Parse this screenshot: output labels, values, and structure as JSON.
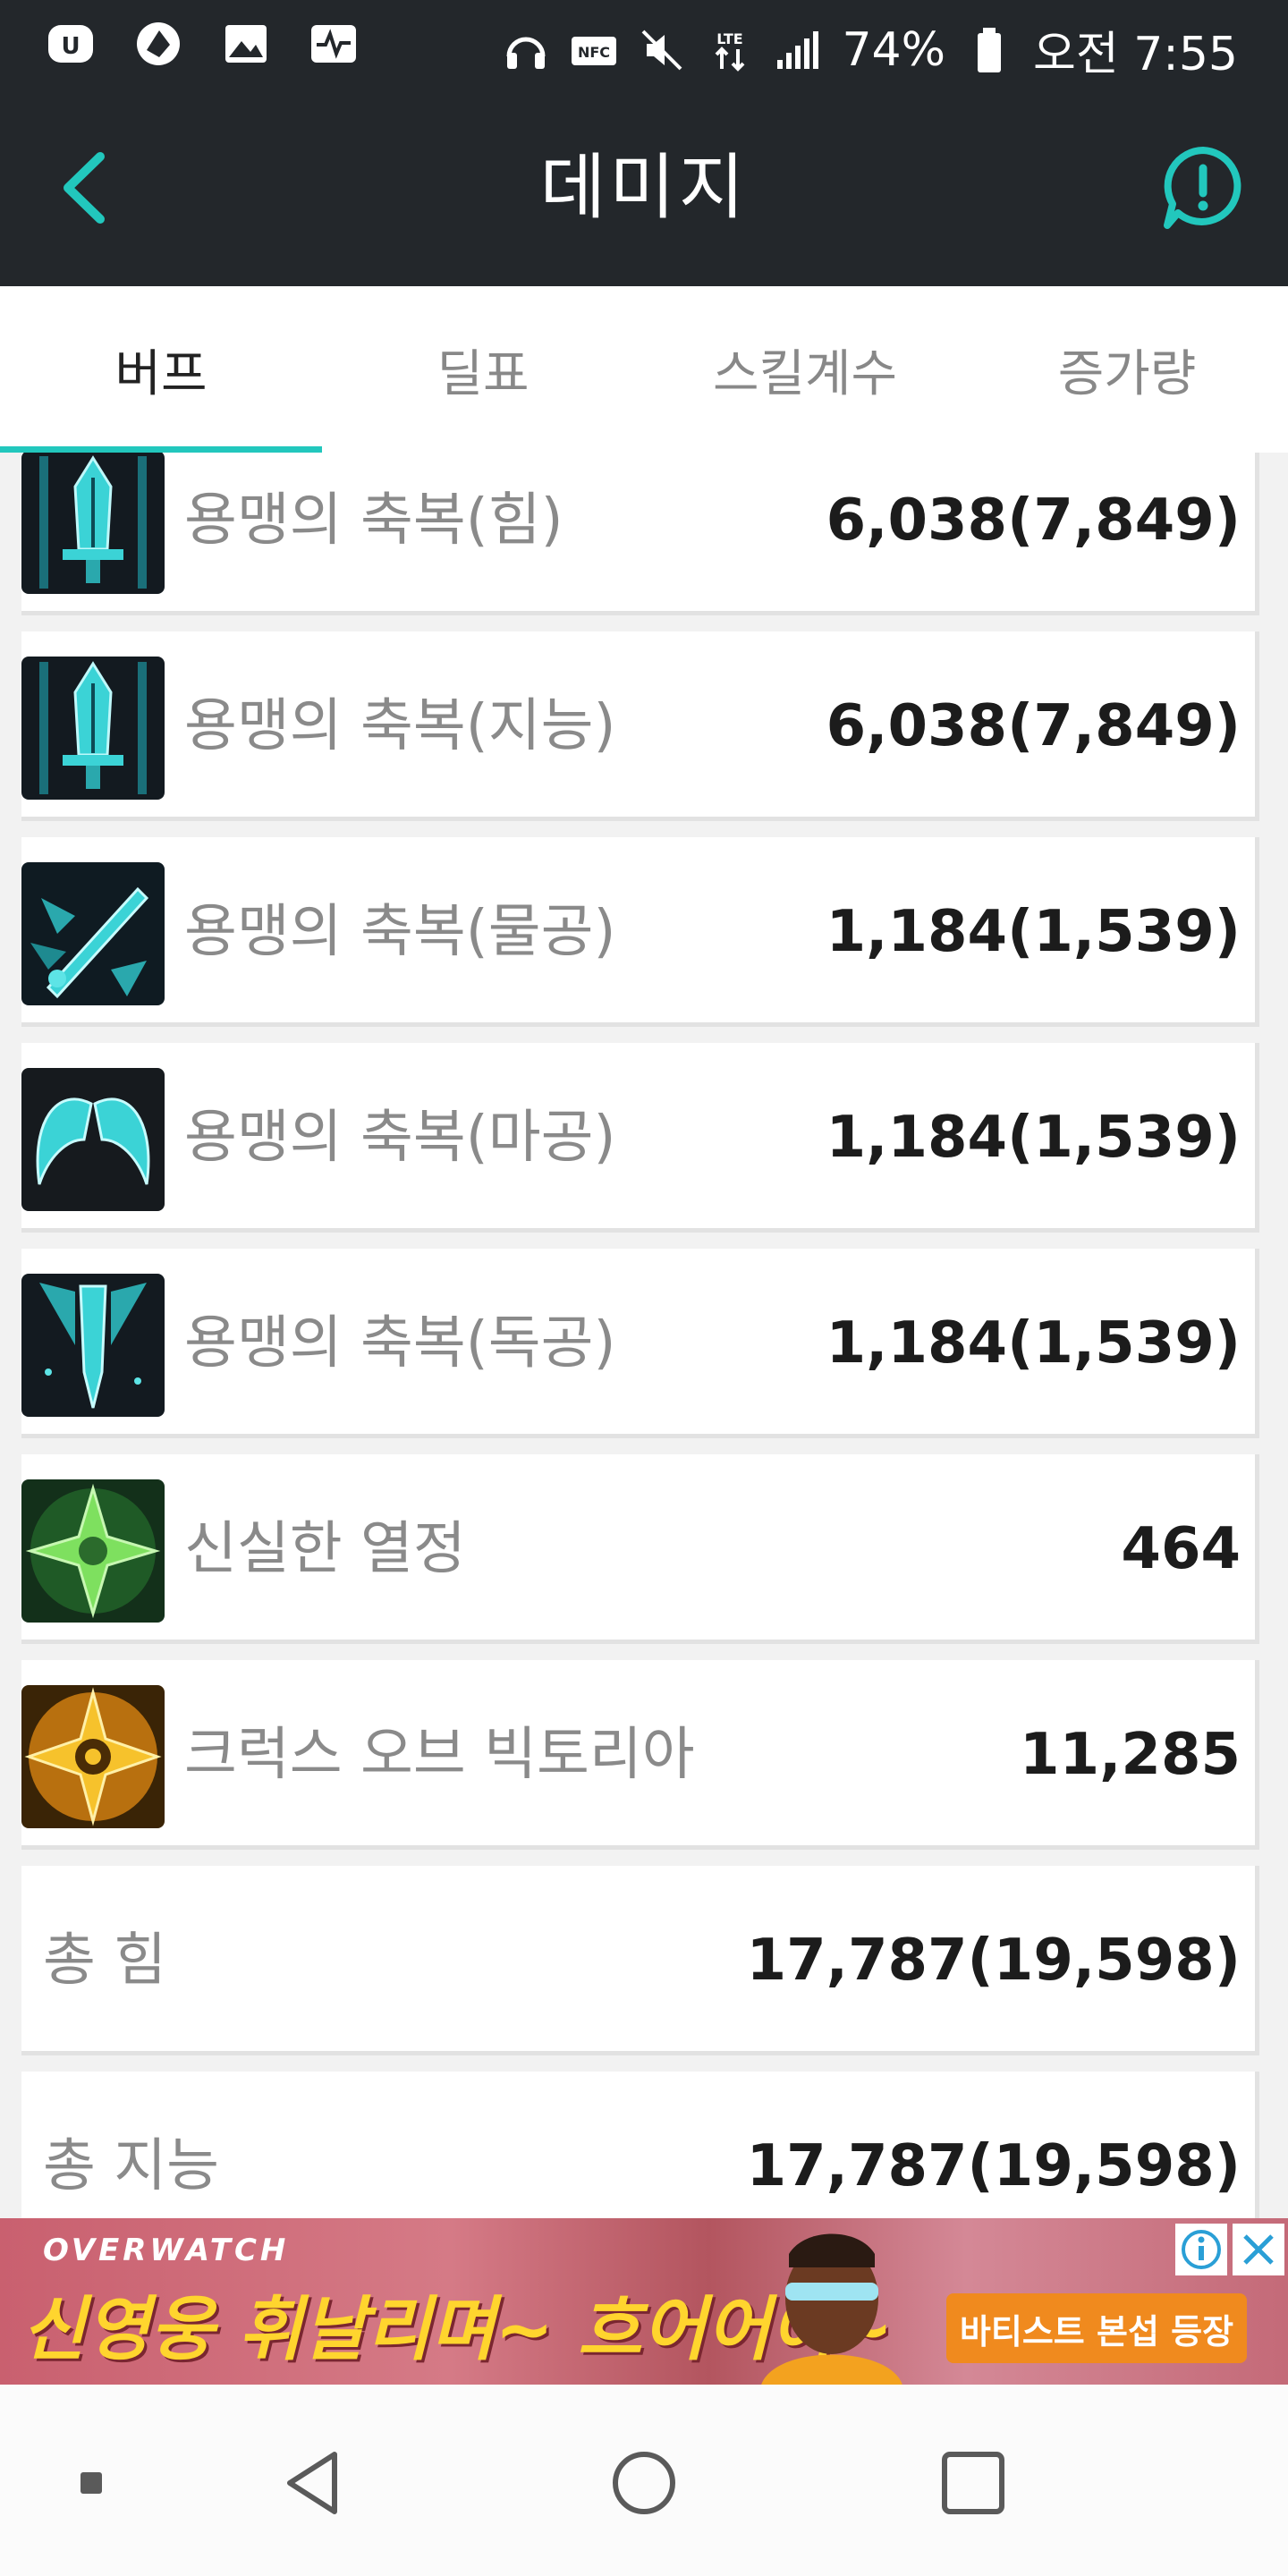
{
  "status_bar": {
    "battery": "74%",
    "time": "오전 7:55",
    "left_icons": [
      "cloud-app-icon",
      "game-app-icon",
      "image-icon",
      "activity-icon"
    ],
    "right_icons": [
      "headset-icon",
      "nfc-icon",
      "mute-icon",
      "lte-icon",
      "signal-icon",
      "battery-icon"
    ]
  },
  "app_bar": {
    "title": "데미지",
    "accent": "#22c7bd"
  },
  "tabs": [
    {
      "label": "버프",
      "active": true
    },
    {
      "label": "딜표",
      "active": false
    },
    {
      "label": "스킬계수",
      "active": false
    },
    {
      "label": "증가량",
      "active": false
    }
  ],
  "buffs": [
    {
      "icon": "sword-icon",
      "name": "용맹의 축복(힘)",
      "value": "6,038(7,849)"
    },
    {
      "icon": "sword-icon",
      "name": "용맹의 축복(지능)",
      "value": "6,038(7,849)"
    },
    {
      "icon": "crossed-swords-icon",
      "name": "용맹의 축복(물공)",
      "value": "1,184(1,539)"
    },
    {
      "icon": "wings-icon",
      "name": "용맹의 축복(마공)",
      "value": "1,184(1,539)"
    },
    {
      "icon": "dagger-icon",
      "name": "용맹의 축복(독공)",
      "value": "1,184(1,539)"
    },
    {
      "icon": "green-cross-icon",
      "name": "신실한 열정",
      "value": "464"
    },
    {
      "icon": "gold-cross-icon",
      "name": "크럭스 오브 빅토리아",
      "value": "11,285"
    }
  ],
  "totals": [
    {
      "name": "총 힘",
      "value": "17,787(19,598)"
    },
    {
      "name": "총 지능",
      "value": "17,787(19,598)"
    }
  ],
  "ad": {
    "brand": "OVERWATCH",
    "headline": "신영웅 휘날리며~ 흐어어어~",
    "cta": "바티스트 본섭 등장"
  },
  "nav_bar": {
    "buttons": [
      "recents-dot-icon",
      "back-triangle-icon",
      "home-circle-icon",
      "overview-square-icon"
    ]
  }
}
